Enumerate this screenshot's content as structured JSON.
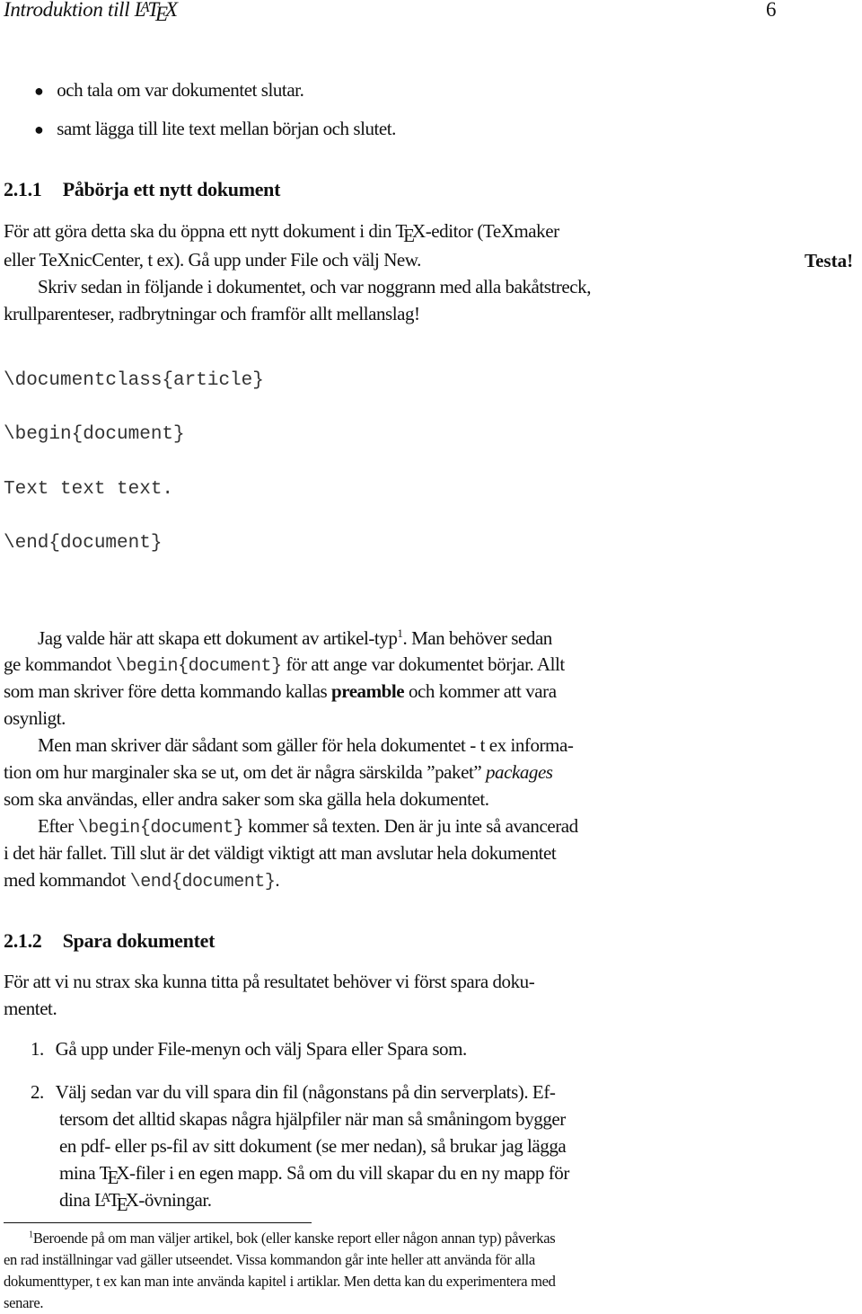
{
  "header": {
    "title_prefix": "Introduktion till L",
    "title_a": "A",
    "title_t": "T",
    "title_e": "E",
    "title_x": "X",
    "page_number": "6"
  },
  "bullets": [
    "och tala om var dokumentet slutar.",
    "samt lägga till lite text mellan början och slutet."
  ],
  "section_1": {
    "number": "2.1.1",
    "title": "Påbörja ett nytt dokument",
    "para1_line1_a": "För att göra detta ska du öppna ett nytt dokument i din T",
    "para1_line1_e": "E",
    "para1_line1_b": "X-editor (TeXmaker",
    "para1_line2": "eller TeXnicCenter, t ex). Gå upp under File och välj New.",
    "margin_note": "Testa!",
    "para2_line1": "Skriv sedan in följande i dokumentet, och var noggrann med alla bakåtstreck,",
    "para2_line2": "krullparenteser, radbrytningar och framför allt mellanslag!",
    "code_lines": [
      "\\documentclass{article}",
      "\\begin{document}",
      "Text text text.",
      "\\end{document}"
    ],
    "para3": {
      "l1_a": "Jag valde här att skapa ett dokument av artikel-typ",
      "l1_sup": "1",
      "l1_b": ". Man behöver sedan",
      "l2_a": "ge kommandot ",
      "l2_code": "\\begin{document}",
      "l2_b": " för att ange var dokumentet börjar. Allt",
      "l3_a": "som man skriver före detta kommando kallas ",
      "l3_bold": "preamble",
      "l3_b": " och kommer att vara",
      "l4": "osynligt."
    },
    "para4": {
      "l1": "Men man skriver där sådant som gäller för hela dokumentet - t ex informa-",
      "l2_a": "tion om hur marginaler ska se ut, om det är några särskilda ”paket” ",
      "l2_italic": "packages",
      "l3": "som ska användas, eller andra saker som ska gälla hela dokumentet."
    },
    "para5": {
      "l1_a": "Efter ",
      "l1_code": "\\begin{document}",
      "l1_b": " kommer så texten. Den är ju inte så avancerad",
      "l2": "i det här fallet. Till slut är det väldigt viktigt att man avslutar hela dokumentet",
      "l3_a": "med kommandot ",
      "l3_code": "\\end{document}",
      "l3_b": "."
    }
  },
  "section_2": {
    "number": "2.1.2",
    "title": "Spara dokumentet",
    "intro_l1": "För att vi nu strax ska kunna titta på resultatet behöver vi först spara doku-",
    "intro_l2": "mentet.",
    "steps": [
      {
        "num": "1.",
        "l1": "Gå upp under File-menyn och välj Spara eller Spara som."
      },
      {
        "num": "2.",
        "l1": "Välj sedan var du vill spara din fil (någonstans på din serverplats). Ef-",
        "l2": "tersom det alltid skapas några hjälpfiler när man så småningom bygger",
        "l3": "en pdf- eller ps-fil av sitt dokument (se mer nedan), så brukar jag lägga",
        "l4_a": "mina T",
        "l4_e": "E",
        "l4_b": "X-filer i en egen mapp. Så om du vill skapar du en ny mapp för",
        "l5_a": "dina L",
        "l5_la": "A",
        "l5_t": "T",
        "l5_e": "E",
        "l5_b": "X-övningar."
      }
    ]
  },
  "footnote": {
    "mark": "1",
    "l1": "Beroende på om man väljer artikel, bok (eller kanske report eller någon annan typ) påverkas",
    "l2": "en rad inställningar vad gäller utseendet. Vissa kommandon går inte heller att använda för alla",
    "l3": "dokumenttyper, t ex kan man inte använda kapitel i artiklar. Men detta kan du experimentera med",
    "l4": "senare."
  }
}
